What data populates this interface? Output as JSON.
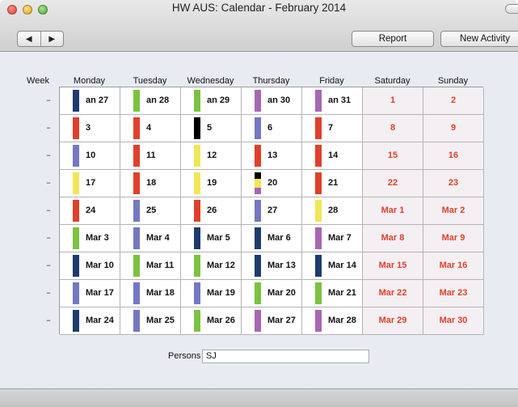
{
  "window": {
    "title": "HW AUS: Calendar - February 2014"
  },
  "toolbar": {
    "prev_icon": "◀",
    "next_icon": "▶",
    "report_label": "Report",
    "new_activity_label": "New Activity"
  },
  "calendar": {
    "week_header": "Week",
    "day_headers": [
      "Monday",
      "Tuesday",
      "Wednesday",
      "Thursday",
      "Friday",
      "Saturday",
      "Sunday"
    ],
    "week_marker": "–",
    "colors": {
      "navy": "#1d3c6e",
      "green": "#7cc241",
      "purple": "#a866b6",
      "red": "#e0402a",
      "blue": "#7478c4",
      "yellow": "#f2e656",
      "black": "#000000",
      "weekend_text": "#e0402a"
    },
    "weeks": [
      {
        "days": [
          {
            "label": "an 27",
            "color": "navy"
          },
          {
            "label": "an 28",
            "color": "green"
          },
          {
            "label": "an 29",
            "color": "green"
          },
          {
            "label": "an 30",
            "color": "purple"
          },
          {
            "label": "an 31",
            "color": "purple"
          },
          {
            "label": "1"
          },
          {
            "label": "2"
          }
        ]
      },
      {
        "days": [
          {
            "label": "3",
            "color": "red"
          },
          {
            "label": "4",
            "color": "red"
          },
          {
            "label": "5",
            "color": "black"
          },
          {
            "label": "6",
            "color": "blue"
          },
          {
            "label": "7",
            "color": "red"
          },
          {
            "label": "8"
          },
          {
            "label": "9"
          }
        ]
      },
      {
        "days": [
          {
            "label": "10",
            "color": "blue"
          },
          {
            "label": "11",
            "color": "red"
          },
          {
            "label": "12",
            "color": "yellow"
          },
          {
            "label": "13",
            "color": "red"
          },
          {
            "label": "14",
            "color": "red"
          },
          {
            "label": "15"
          },
          {
            "label": "16"
          }
        ]
      },
      {
        "days": [
          {
            "label": "17",
            "color": "yellow"
          },
          {
            "label": "18",
            "color": "red"
          },
          {
            "label": "19",
            "color": "yellow"
          },
          {
            "label": "20",
            "color": "split"
          },
          {
            "label": "21",
            "color": "red"
          },
          {
            "label": "22"
          },
          {
            "label": "23"
          }
        ]
      },
      {
        "days": [
          {
            "label": "24",
            "color": "red"
          },
          {
            "label": "25",
            "color": "blue"
          },
          {
            "label": "26",
            "color": "red"
          },
          {
            "label": "27",
            "color": "blue"
          },
          {
            "label": "28",
            "color": "yellow"
          },
          {
            "label": "Mar 1"
          },
          {
            "label": "Mar 2"
          }
        ]
      },
      {
        "days": [
          {
            "label": "Mar 3",
            "color": "green"
          },
          {
            "label": "Mar 4",
            "color": "blue"
          },
          {
            "label": "Mar 5",
            "color": "navy"
          },
          {
            "label": "Mar 6",
            "color": "navy"
          },
          {
            "label": "Mar 7",
            "color": "purple"
          },
          {
            "label": "Mar 8"
          },
          {
            "label": "Mar 9"
          }
        ]
      },
      {
        "days": [
          {
            "label": "Mar 10",
            "color": "navy"
          },
          {
            "label": "Mar 11",
            "color": "green"
          },
          {
            "label": "Mar 12",
            "color": "green"
          },
          {
            "label": "Mar 13",
            "color": "navy"
          },
          {
            "label": "Mar 14",
            "color": "navy"
          },
          {
            "label": "Mar 15"
          },
          {
            "label": "Mar 16"
          }
        ]
      },
      {
        "days": [
          {
            "label": "Mar 17",
            "color": "blue"
          },
          {
            "label": "Mar 18",
            "color": "blue"
          },
          {
            "label": "Mar 19",
            "color": "blue"
          },
          {
            "label": "Mar 20",
            "color": "green"
          },
          {
            "label": "Mar 21",
            "color": "green"
          },
          {
            "label": "Mar 22"
          },
          {
            "label": "Mar 23"
          }
        ]
      },
      {
        "days": [
          {
            "label": "Mar 24",
            "color": "navy"
          },
          {
            "label": "Mar 25",
            "color": "blue"
          },
          {
            "label": "Mar 26",
            "color": "green"
          },
          {
            "label": "Mar 27",
            "color": "purple"
          },
          {
            "label": "Mar 28",
            "color": "purple"
          },
          {
            "label": "Mar 29"
          },
          {
            "label": "Mar 30"
          }
        ]
      }
    ]
  },
  "persons": {
    "label": "Persons",
    "value": "SJ"
  }
}
